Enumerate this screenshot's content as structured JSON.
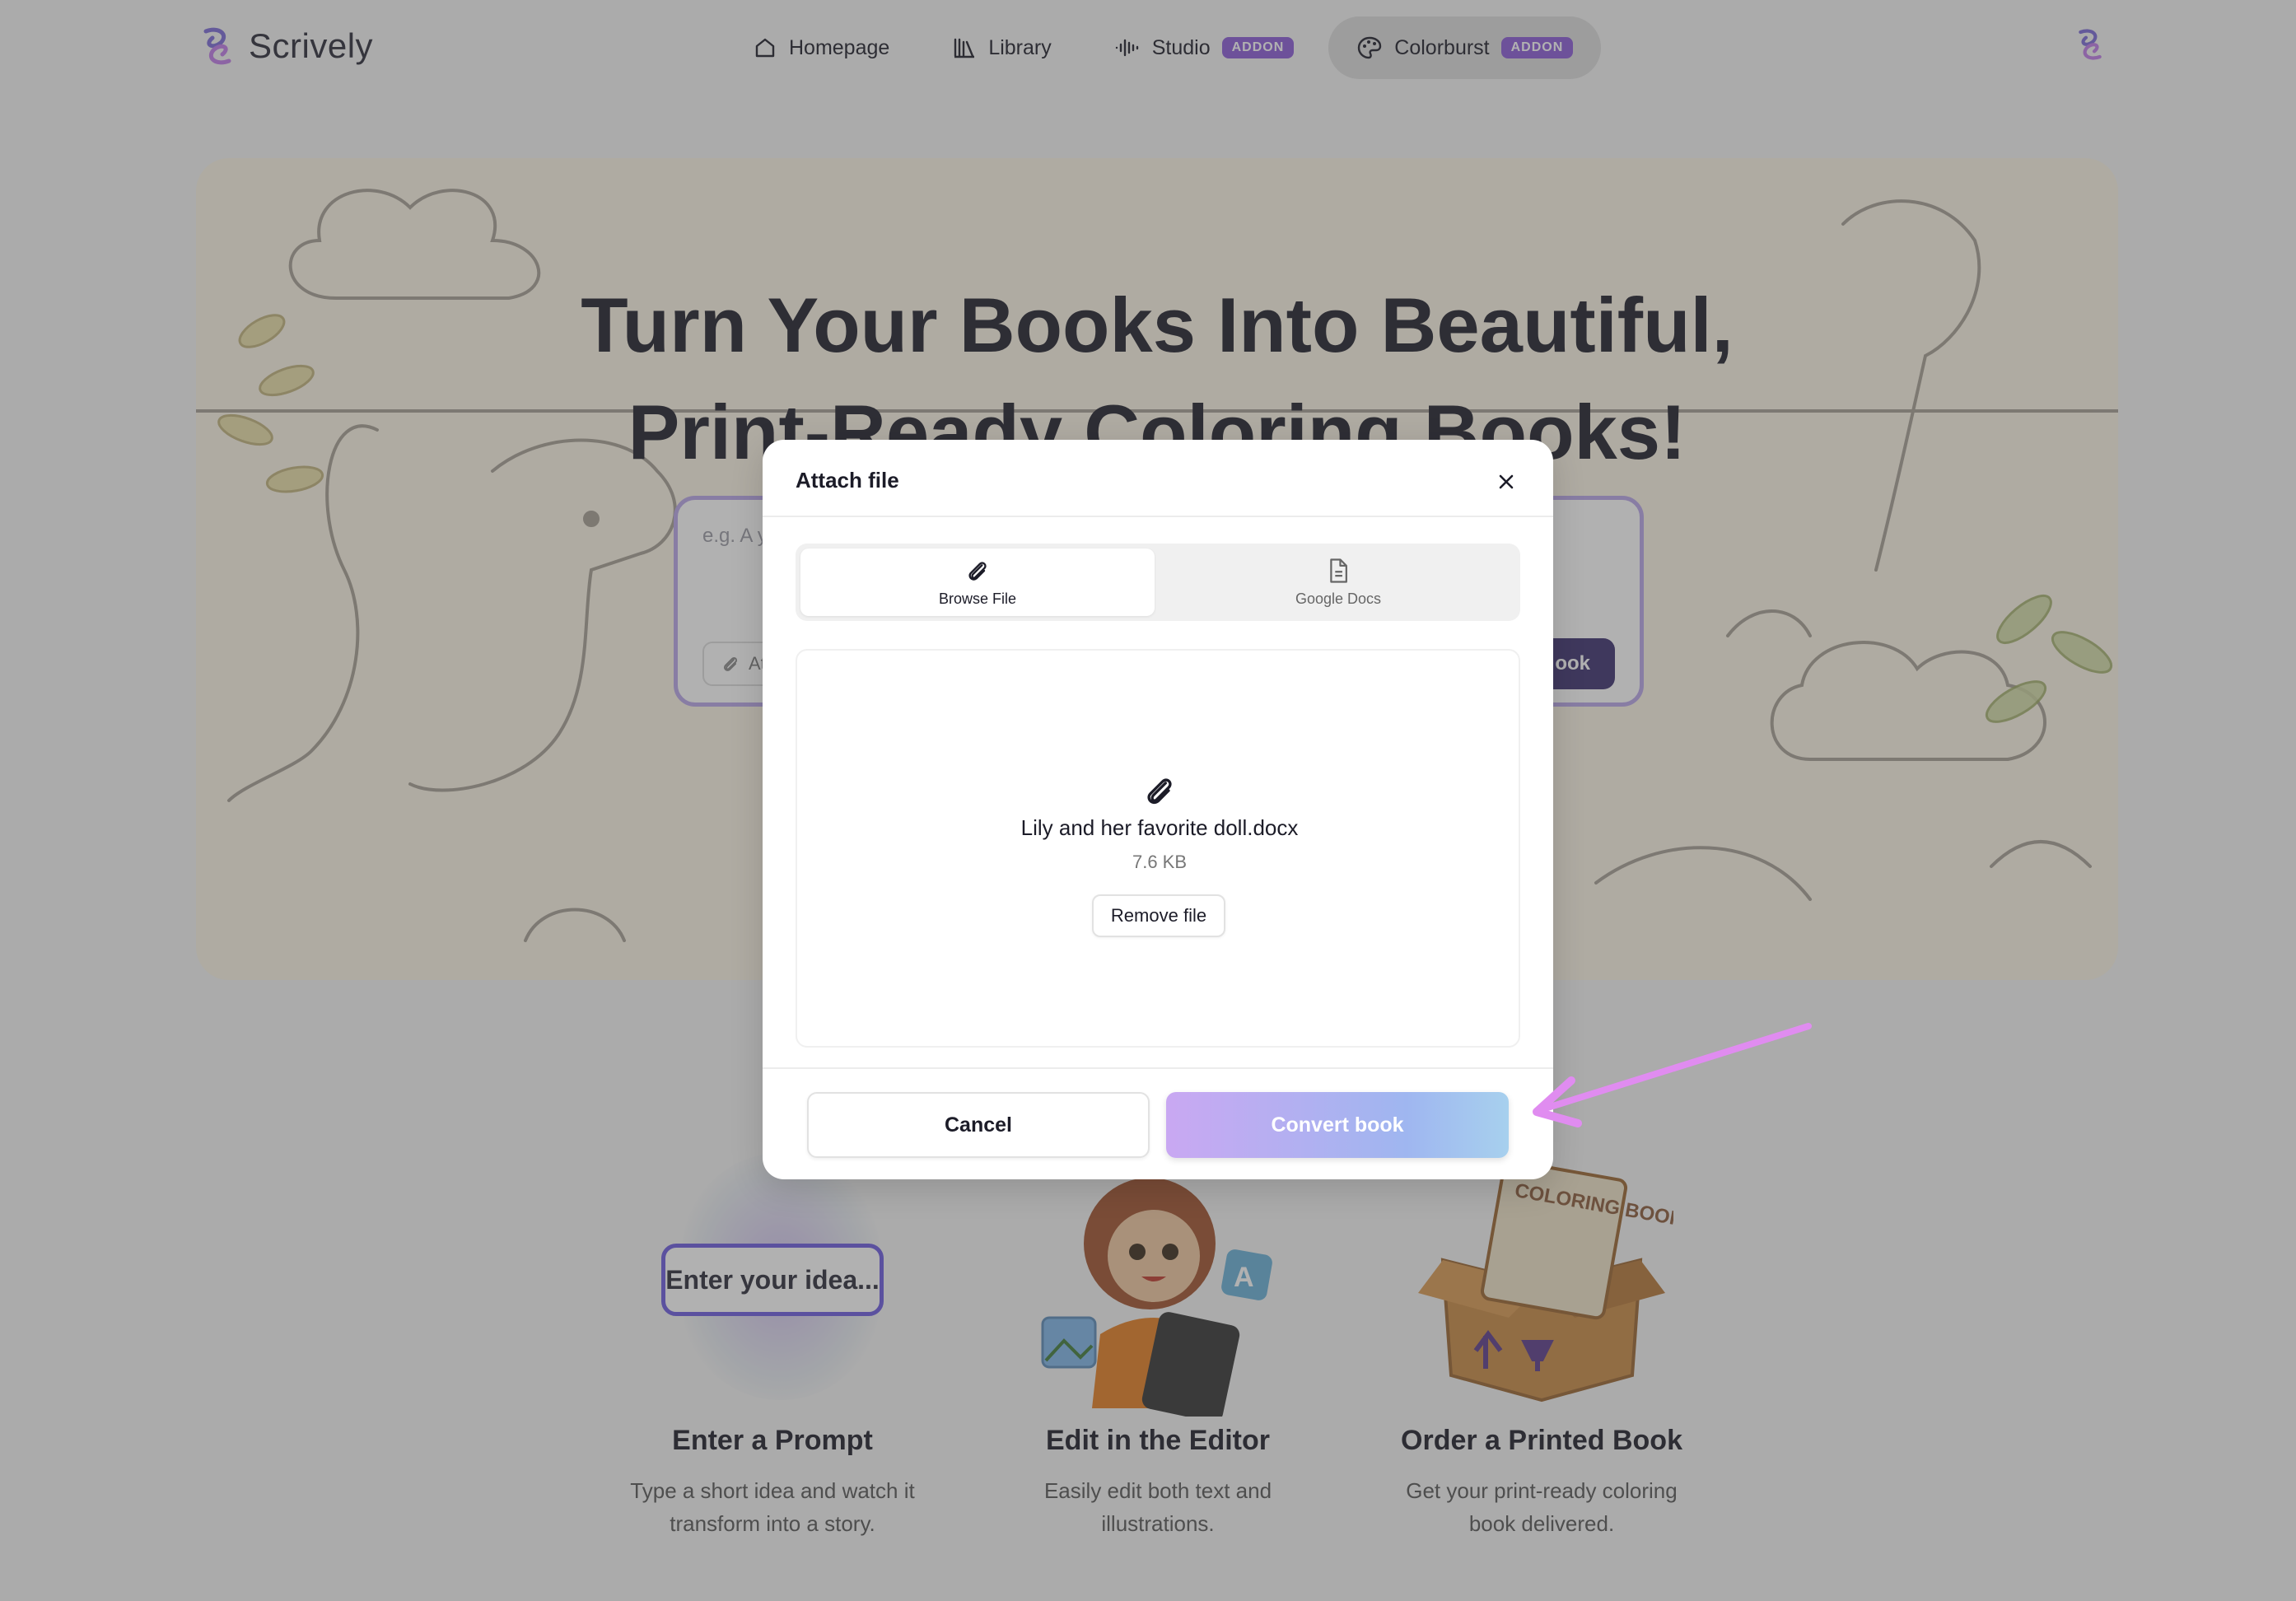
{
  "app": {
    "name": "Scrively"
  },
  "nav": {
    "items": [
      {
        "label": "Homepage",
        "icon": "home-icon",
        "addon": ""
      },
      {
        "label": "Library",
        "icon": "library-icon",
        "addon": ""
      },
      {
        "label": "Studio",
        "icon": "waveform-icon",
        "addon": "ADDON"
      },
      {
        "label": "Colorburst",
        "icon": "palette-icon",
        "addon": "ADDON"
      }
    ],
    "active": "Colorburst"
  },
  "hero": {
    "title_line1": "Turn Your Books Into Beautiful,",
    "title_line2": "Print-Ready Coloring Books!",
    "prompt_placeholder": "e.g. A y",
    "attach_label": "At",
    "convert_label": "ook"
  },
  "steps": [
    {
      "title": "Enter a Prompt",
      "desc_line1": "Type a short idea and watch it",
      "desc_line2": "transform into a story.",
      "mock_input": "Enter your idea..."
    },
    {
      "title": "Edit in the Editor",
      "desc_line1": "Easily edit both text and",
      "desc_line2": "illustrations."
    },
    {
      "title": "Order a Printed Book",
      "desc_line1": "Get your print-ready coloring",
      "desc_line2": "book delivered.",
      "box_label": "COLORING BOOK"
    }
  ],
  "modal": {
    "title": "Attach file",
    "tabs": [
      {
        "label": "Browse File",
        "icon": "paperclip-icon"
      },
      {
        "label": "Google Docs",
        "icon": "document-icon"
      }
    ],
    "active_tab": "Browse File",
    "file": {
      "name": "Lily and her favorite doll.docx",
      "size": "7.6 KB"
    },
    "remove_label": "Remove file",
    "cancel_label": "Cancel",
    "convert_label": "Convert book"
  },
  "colors": {
    "accent": "#8a5ad8",
    "overlay": "rgba(70,70,70,0.42)",
    "annotation_arrow": "#e08cf0"
  }
}
